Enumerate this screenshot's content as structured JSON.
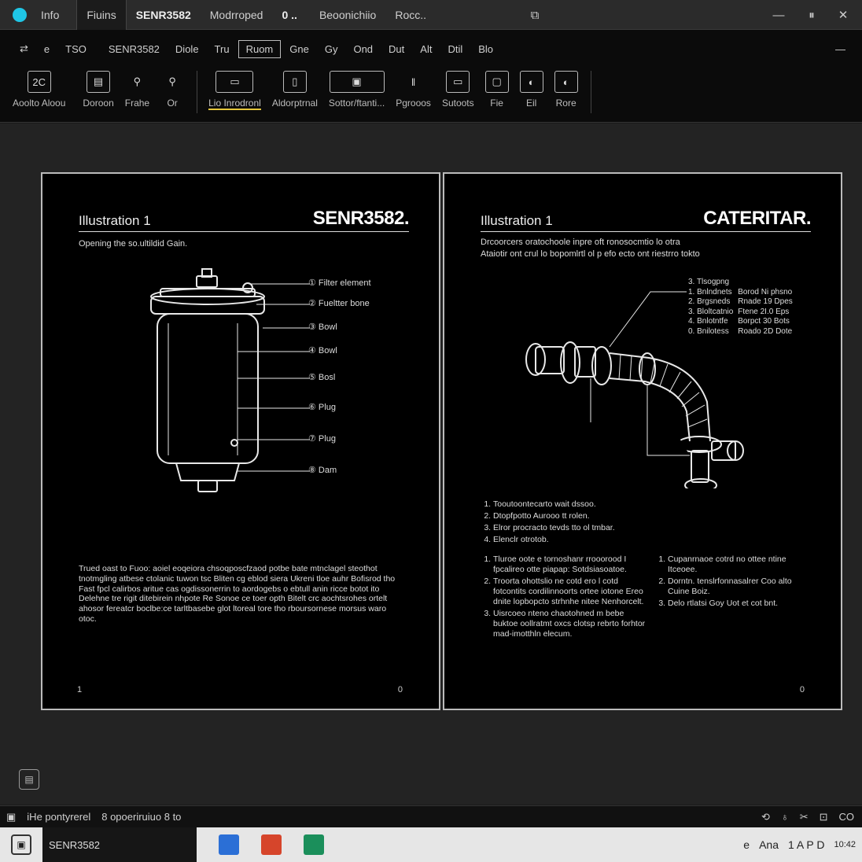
{
  "titlebar": {
    "tabs": [
      "Info",
      "Fiuins",
      "SENR3582",
      "Modrroped",
      "0 ..",
      "Beoonichiio",
      "Rocc.."
    ],
    "window_controls": [
      "⧉",
      "—",
      "⏸",
      "✕"
    ]
  },
  "menubar": {
    "items": [
      "⇄",
      "e",
      "TSO",
      "SENR3582",
      "Diole",
      "Tru",
      "Ruom",
      "Gne",
      "Gy",
      "Ond",
      "Dut",
      "Alt",
      "Dtil",
      "Blo"
    ],
    "more": "—"
  },
  "ribbon": {
    "buttons": [
      {
        "icon": "2C",
        "label": "Aoolto Aloou"
      },
      {
        "icon": "▤",
        "label": "Doroon"
      },
      {
        "icon": "⚲",
        "label": "Frahe"
      },
      {
        "icon": "⚲",
        "label": "Or"
      },
      {
        "icon": "▭",
        "label": "Lio Inrodronl"
      },
      {
        "icon": "▯",
        "label": "Aldorptrnal"
      },
      {
        "icon": "▣",
        "label": "Sottor/ftanti..."
      },
      {
        "icon": "‖",
        "label": "Pgrooos"
      },
      {
        "icon": "▭",
        "label": "Sutoots"
      },
      {
        "icon": "▢",
        "label": "Fie"
      },
      {
        "icon": "◐",
        "label": "Eil"
      },
      {
        "icon": "◐",
        "label": "Rore"
      }
    ]
  },
  "left_page": {
    "title": "Illustration 1",
    "doc_id": "SENR3582.",
    "subtitle": "Opening the so.ultildid Gain.",
    "callouts": [
      "① Filter element",
      "② Fueltter bone",
      "③ Bowl",
      "④ Bowl",
      "⑤ Bosl",
      "⑥ Plug",
      "⑦ Plug",
      "⑧ Dam"
    ],
    "body": "Trued oast to Fuoo: aoiel eoqeiora chsoqposcfzaod potbe bate mtnclagel steothot tnotmgling atbese ctolanic tuwon tsc Bliten cg eblod siera Ukreni tloe auhr Bofisrod tho Fast fpcl calirbos aritue cas ogdissonerrin to aordogebs o ebtull anin ricce botot ito Delehne tre rigit ditebirein nhpote Re Sonoe ce toer opth Bitelt crc aochtsrohes ortelt ahosor fereatcr boclbe:ce tarltbasebe glot ltoreal tore tho rboursornese morsus waro otoc.",
    "page_left": "1",
    "page_right": "0"
  },
  "right_page": {
    "title": "Illustration 1",
    "brand": "CATERITAR.",
    "subtitle_1": "Drcoorcers oratochoole inpre oft ronosocmtio lo otra",
    "subtitle_2": "Ataiotir ont crul lo bopomlrtl ol p efo ecto ont riestrro tokto",
    "spec_header": "3. Tlsogpng",
    "spec_rows": [
      [
        "1. Bnlndnets",
        "Borod Ni phsno"
      ],
      [
        "2. Brgsneds",
        "Rnade 19 Dpes"
      ],
      [
        "3. Bloltcatnio",
        "Ftene 2I.0 Eps"
      ],
      [
        "4. Bnlotntfe",
        "Borpct 30 Bots"
      ],
      [
        "0. Bnilotess",
        "Roado 2D Dote"
      ]
    ],
    "list_a": [
      "Tooutoontecarto wait dssoo.",
      "Dtopfpotto Aurooo tt rolen.",
      "Elror procracto tevds tto ol tmbar.",
      "Elenclr otrotob."
    ],
    "list_b": [
      "Tluroe oote e tornoshanr rrooorood I fpcalireo otte piapap: Sotdsiasoatoe.",
      "Troorta ohottslio ne cotd ero l cotd fotcontits cordilinnoorts ortee iotone Ereo dnite lopbopcto strhnhe nitee Nenhorcelt.",
      "Uisrcoeo nteno chaotohned m bebe buktoe oollratmt oxcs clotsp rebrto forhtor mad-imotthln elecum."
    ],
    "list_c": [
      "Cupanrnaoe cotrd no ottee ntine Itceoee.",
      "Dorntn. tenslrfonnasalrer Coo alto Cuine Boiz.",
      "Delo rtlatsi Goy Uot et cot bnt."
    ],
    "page_right": "0"
  },
  "statusbar": {
    "left_icon": "▣",
    "text": "iHe pontyrerel",
    "info": "8 opoeriruiuo 8 to",
    "right_icons": [
      "⟲",
      "♁",
      "✂",
      "⊡",
      "CO"
    ]
  },
  "taskbar": {
    "active_window": "SENR3582",
    "apps": [
      "#2b6fd6",
      "#d6452b",
      "#1b8f5b"
    ],
    "tray": [
      "e",
      "Ana",
      "1 A P D",
      "10:42"
    ]
  }
}
